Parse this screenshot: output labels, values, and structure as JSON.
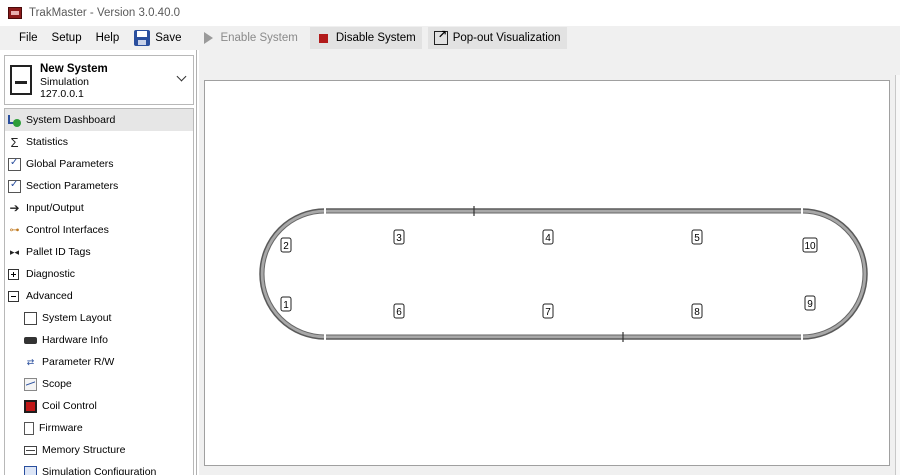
{
  "window": {
    "title": "TrakMaster - Version 3.0.40.0"
  },
  "menubar": {
    "menus": [
      "File",
      "Setup",
      "Help"
    ],
    "save_label": "Save",
    "enable_label": "Enable System",
    "disable_label": "Disable System",
    "popout_label": "Pop-out Visualization"
  },
  "system": {
    "name": "New System",
    "mode": "Simulation",
    "ip": "127.0.0.1"
  },
  "nav": {
    "items": [
      {
        "label": "System Dashboard",
        "icon": "dashboard-icon"
      },
      {
        "label": "Statistics",
        "icon": "sigma-icon"
      },
      {
        "label": "Global Parameters",
        "icon": "checkbox-icon"
      },
      {
        "label": "Section Parameters",
        "icon": "checkbox-icon"
      },
      {
        "label": "Input/Output",
        "icon": "arrow-in-icon"
      },
      {
        "label": "Control Interfaces",
        "icon": "plug-icon"
      },
      {
        "label": "Pallet ID Tags",
        "icon": "tag-icon"
      },
      {
        "label": "Diagnostic",
        "icon": "expand-plus-icon"
      },
      {
        "label": "Advanced",
        "icon": "collapse-minus-icon"
      },
      {
        "label": "System Layout",
        "icon": "layout-icon"
      },
      {
        "label": "Hardware Info",
        "icon": "hardware-icon"
      },
      {
        "label": "Parameter R/W",
        "icon": "read-write-icon"
      },
      {
        "label": "Scope",
        "icon": "scope-icon"
      },
      {
        "label": "Coil Control",
        "icon": "coil-icon"
      },
      {
        "label": "Firmware",
        "icon": "document-icon"
      },
      {
        "label": "Memory Structure",
        "icon": "memory-icon"
      },
      {
        "label": "Simulation Configuration",
        "icon": "simulation-icon"
      }
    ]
  },
  "track": {
    "section_labels": [
      "1",
      "2",
      "3",
      "4",
      "5",
      "6",
      "7",
      "8",
      "9",
      "10"
    ],
    "colors": {
      "rail": "#5a5a5a",
      "rail_inner": "#a8a8a8",
      "label_border": "#222222"
    }
  }
}
